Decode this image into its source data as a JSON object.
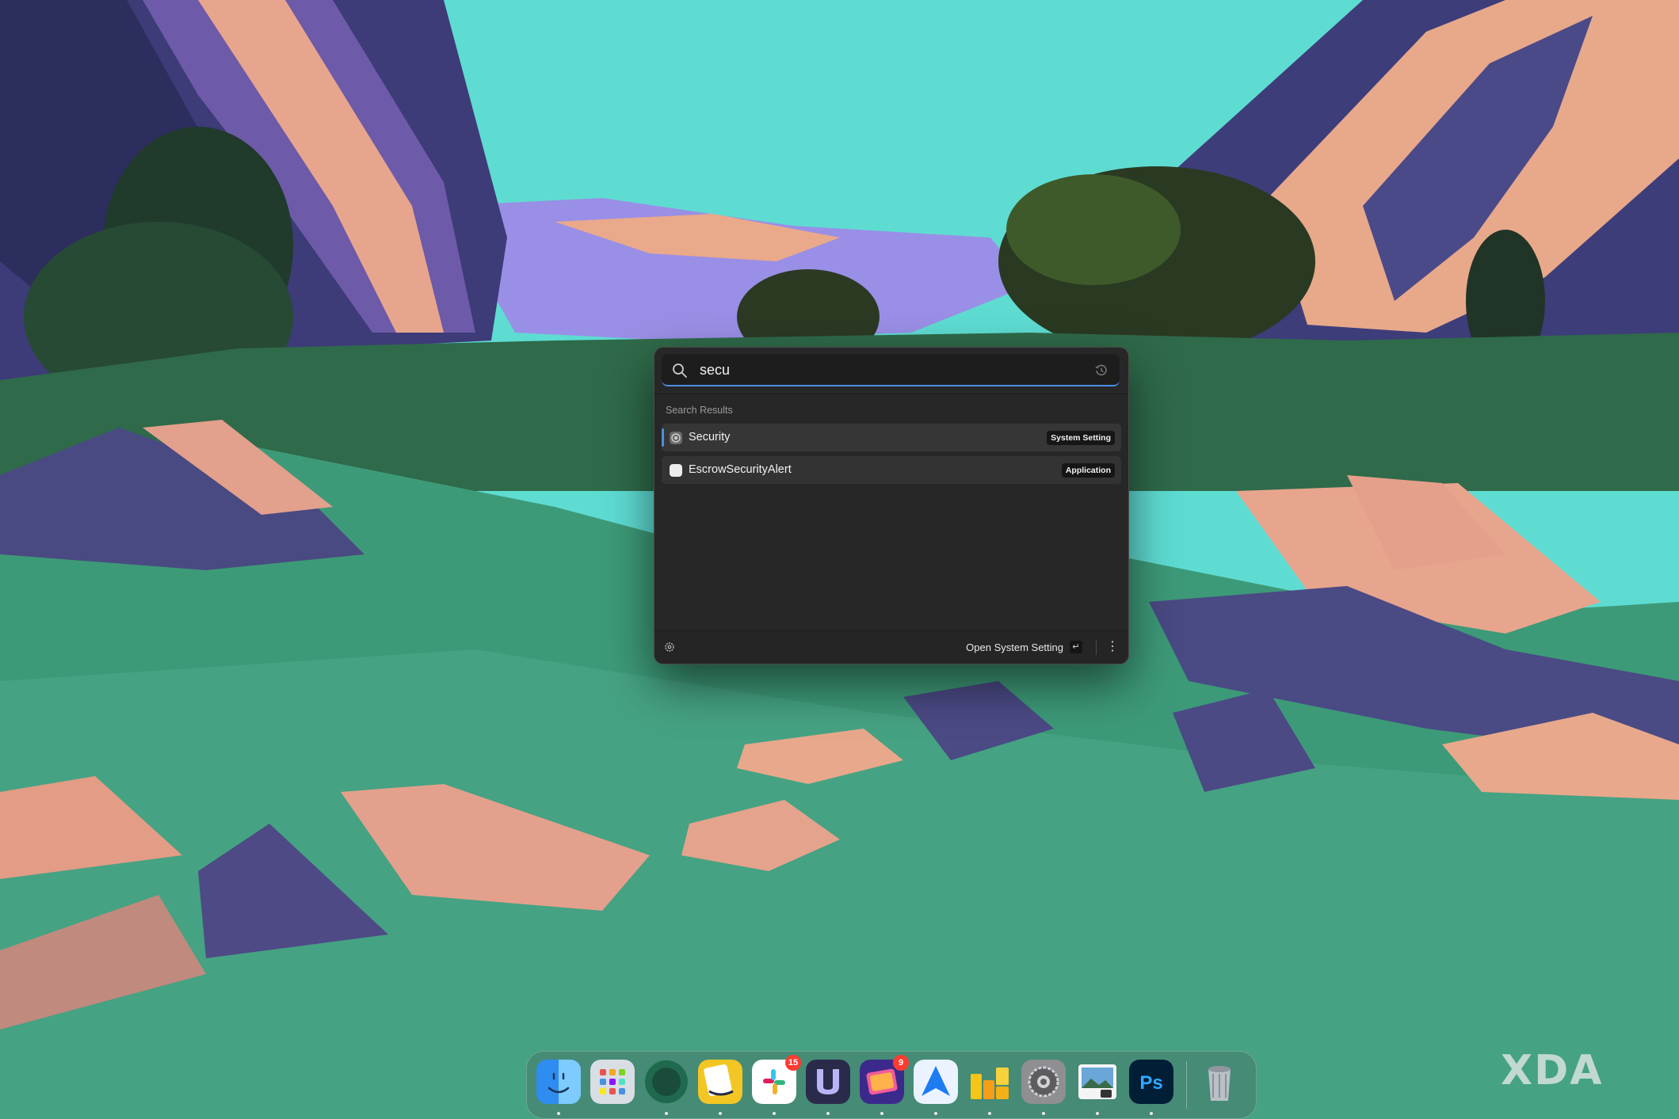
{
  "launcher": {
    "search": {
      "value": "secu",
      "placeholder": ""
    },
    "section_label": "Search Results",
    "results": [
      {
        "label": "Security",
        "badge": "System Setting",
        "icon": "gear-icon",
        "selected": true
      },
      {
        "label": "EscrowSecurityAlert",
        "badge": "Application",
        "icon": "app-icon",
        "selected": false
      }
    ],
    "footer": {
      "action_label": "Open System Setting",
      "enter_key": "↵",
      "more": "⋮"
    },
    "accent": "#4d8ee8"
  },
  "dock": {
    "apps": [
      {
        "name": "finder-icon"
      },
      {
        "name": "launchpad-icon"
      },
      {
        "name": "arc-browser-icon"
      },
      {
        "name": "readkit-icon"
      },
      {
        "name": "slack-icon",
        "badge": "15"
      },
      {
        "name": "vectorize-icon"
      },
      {
        "name": "notchmeister-icon",
        "badge": "9"
      },
      {
        "name": "spark-mail-icon"
      },
      {
        "name": "artstudio-icon"
      },
      {
        "name": "system-settings-icon"
      },
      {
        "name": "preview-icon"
      },
      {
        "name": "photoshop-icon",
        "text": "Ps"
      },
      {
        "name": "trash-icon"
      }
    ]
  },
  "watermark": "XDA"
}
